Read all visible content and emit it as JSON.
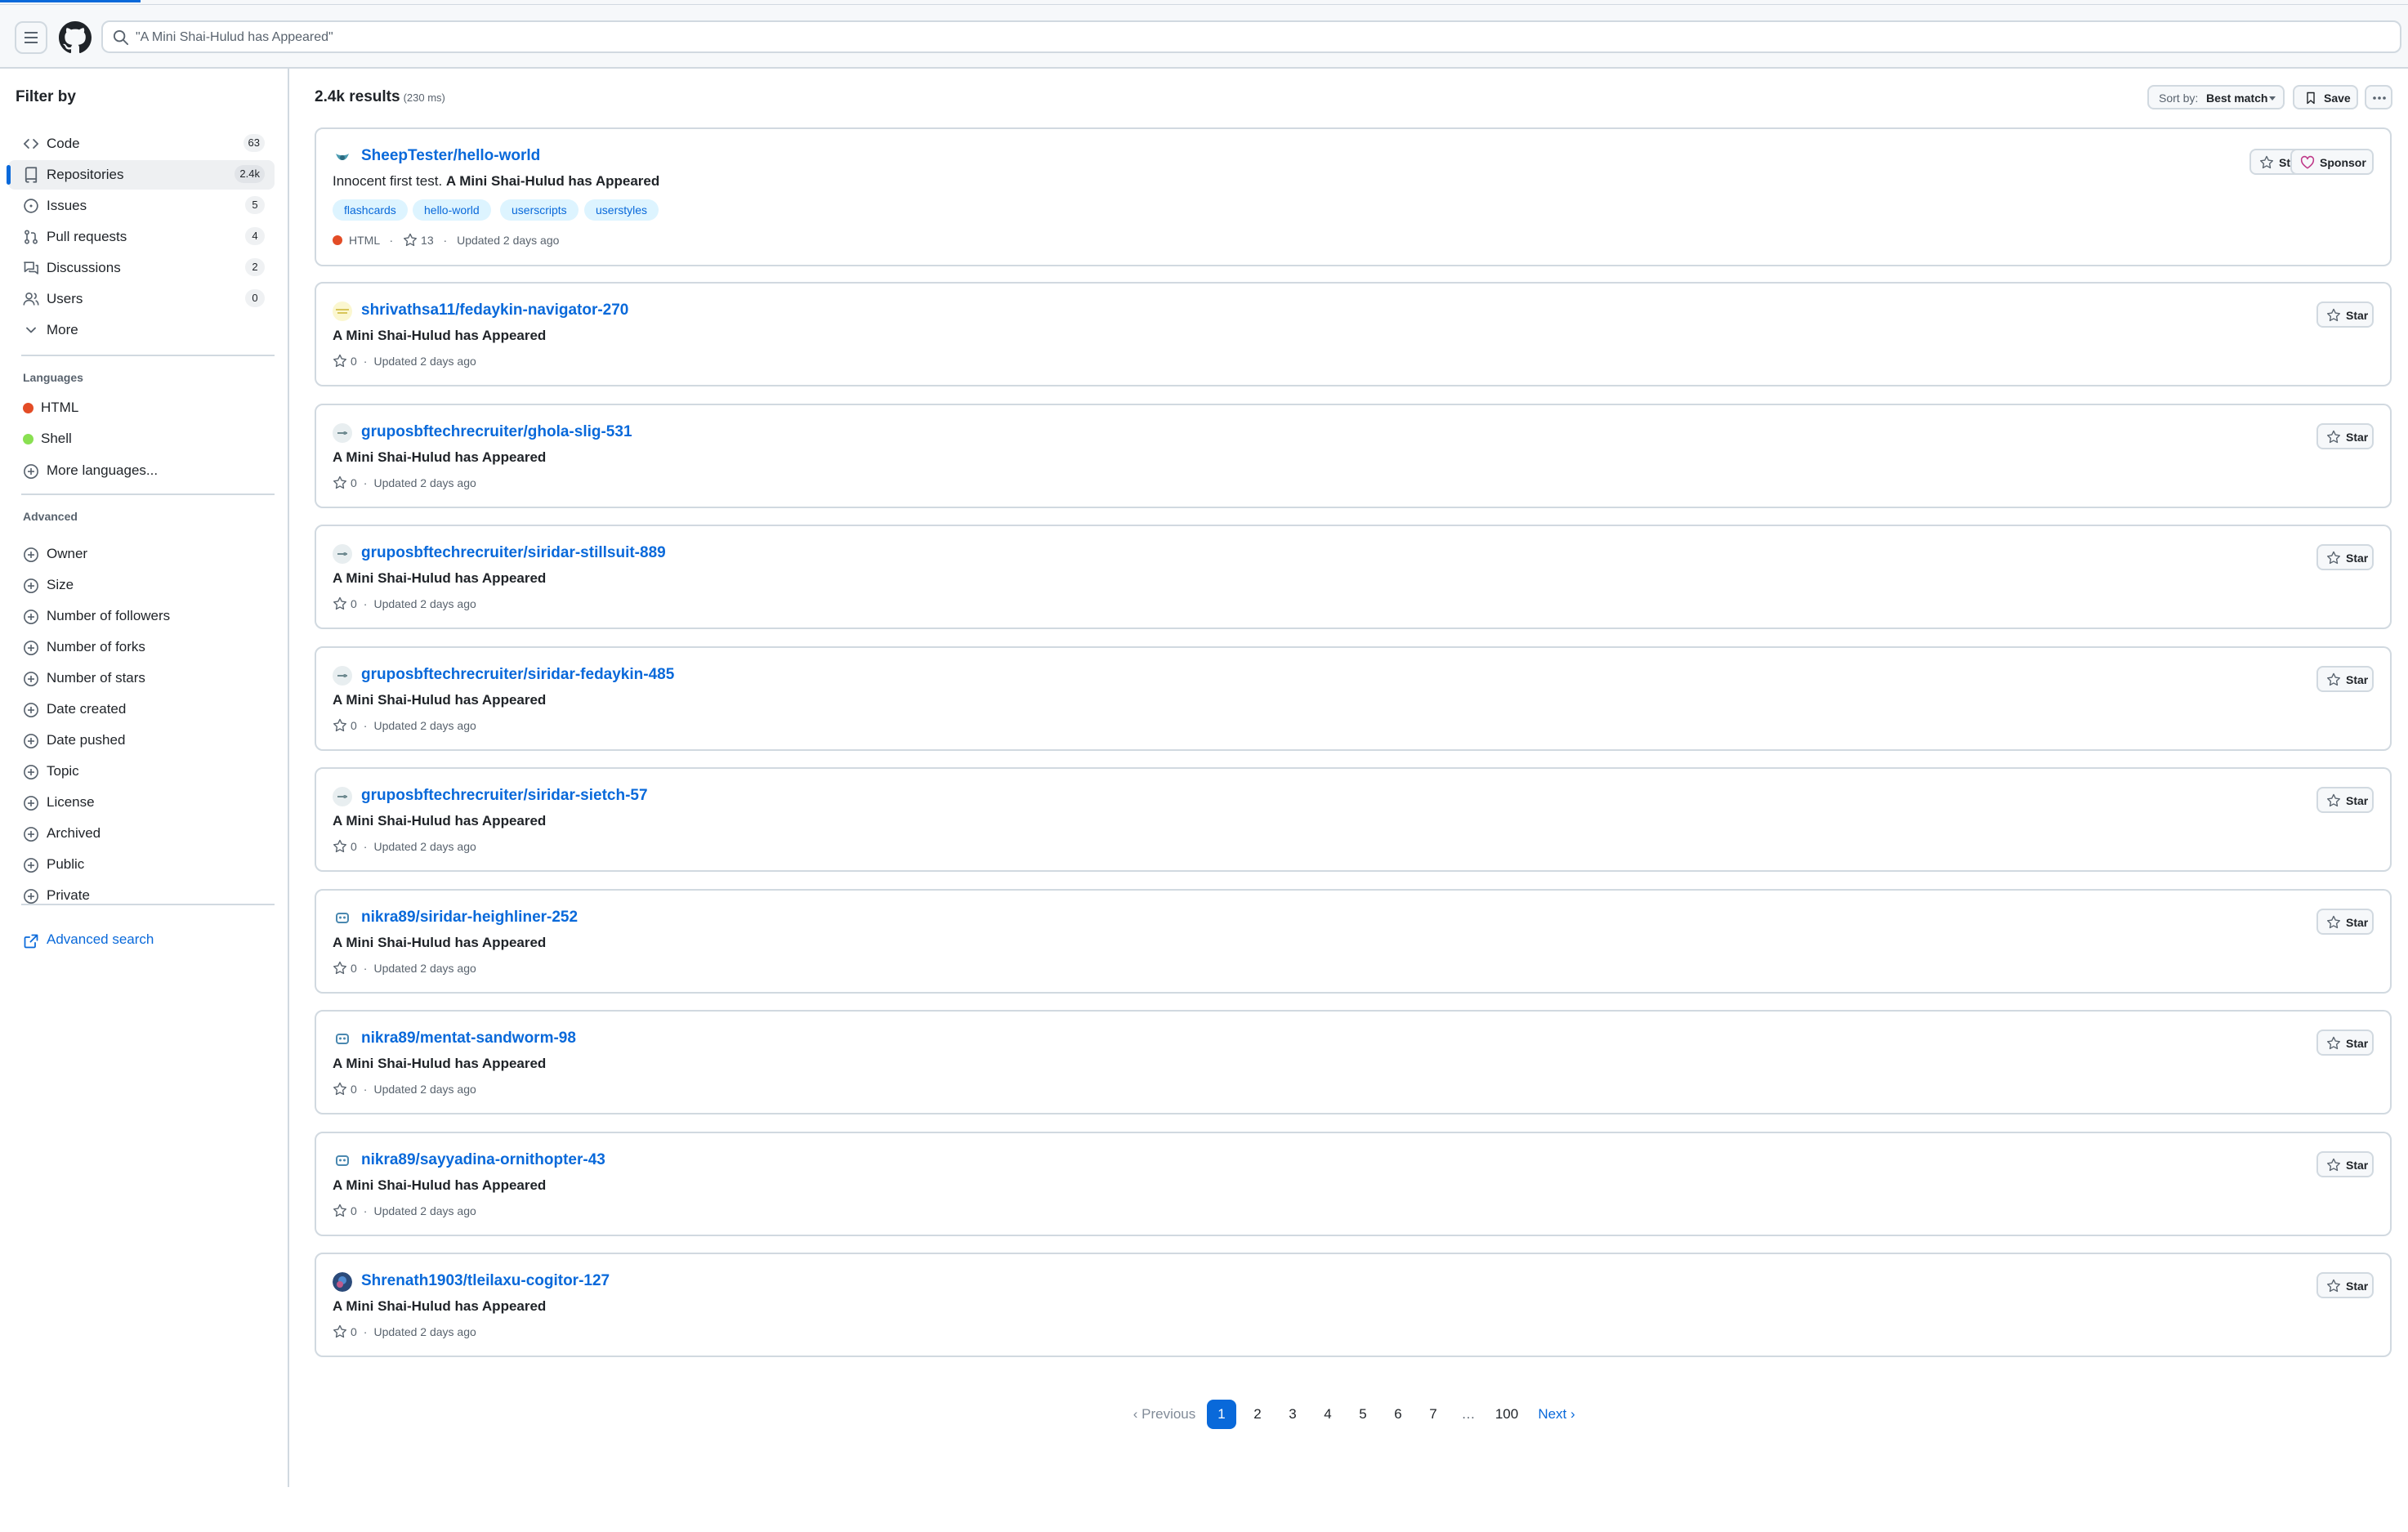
{
  "header": {
    "search_value": "\"A Mini Shai-Hulud has Appeared\""
  },
  "sidebar": {
    "title": "Filter by",
    "types": [
      {
        "label": "Code",
        "count": "63",
        "icon": "code-icon"
      },
      {
        "label": "Repositories",
        "count": "2.4k",
        "icon": "repo-icon",
        "active": true
      },
      {
        "label": "Issues",
        "count": "5",
        "icon": "issue-icon"
      },
      {
        "label": "Pull requests",
        "count": "4",
        "icon": "pull-request-icon"
      },
      {
        "label": "Discussions",
        "count": "2",
        "icon": "discussion-icon"
      },
      {
        "label": "Users",
        "count": "0",
        "icon": "people-icon"
      },
      {
        "label": "More",
        "icon": "chevron-down-icon"
      }
    ],
    "languages_heading": "Languages",
    "languages": [
      {
        "label": "HTML",
        "color": "#e34c26"
      },
      {
        "label": "Shell",
        "color": "#89e051"
      }
    ],
    "more_languages": "More languages...",
    "advanced_heading": "Advanced",
    "advanced": [
      "Owner",
      "Size",
      "Number of followers",
      "Number of forks",
      "Number of stars",
      "Date created",
      "Date pushed",
      "Topic",
      "License",
      "Archived",
      "Public",
      "Private"
    ],
    "advanced_search": "Advanced search"
  },
  "results": {
    "count": "2.4k results",
    "time": "(230 ms)",
    "sort_label": "Sort by:",
    "sort_value": "Best match",
    "save_label": "Save",
    "star_label": "Star",
    "sponsor_label": "Sponsor",
    "items": [
      {
        "repo": "SheepTester/hello-world",
        "desc_prefix": "Innocent first test. ",
        "desc": "A Mini Shai-Hulud has Appeared",
        "topics": [
          "flashcards",
          "hello-world",
          "userscripts",
          "userstyles"
        ],
        "language": "HTML",
        "stars": "13",
        "updated": "Updated 2 days ago"
      },
      {
        "repo": "shrivathsa11/fedaykin-navigator-270",
        "desc_prefix": "",
        "desc": "A Mini Shai-Hulud has Appeared",
        "stars": "0",
        "updated": "Updated 2 days ago"
      },
      {
        "repo": "gruposbftechrecruiter/ghola-slig-531",
        "desc_prefix": "",
        "desc": "A Mini Shai-Hulud has Appeared",
        "stars": "0",
        "updated": "Updated 2 days ago"
      },
      {
        "repo": "gruposbftechrecruiter/siridar-stillsuit-889",
        "desc_prefix": "",
        "desc": "A Mini Shai-Hulud has Appeared",
        "stars": "0",
        "updated": "Updated 2 days ago"
      },
      {
        "repo": "gruposbftechrecruiter/siridar-fedaykin-485",
        "desc_prefix": "",
        "desc": "A Mini Shai-Hulud has Appeared",
        "stars": "0",
        "updated": "Updated 2 days ago"
      },
      {
        "repo": "gruposbftechrecruiter/siridar-sietch-57",
        "desc_prefix": "",
        "desc": "A Mini Shai-Hulud has Appeared",
        "stars": "0",
        "updated": "Updated 2 days ago"
      },
      {
        "repo": "nikra89/siridar-heighliner-252",
        "desc_prefix": "",
        "desc": "A Mini Shai-Hulud has Appeared",
        "stars": "0",
        "updated": "Updated 2 days ago"
      },
      {
        "repo": "nikra89/mentat-sandworm-98",
        "desc_prefix": "",
        "desc": "A Mini Shai-Hulud has Appeared",
        "stars": "0",
        "updated": "Updated 2 days ago"
      },
      {
        "repo": "nikra89/sayyadina-ornithopter-43",
        "desc_prefix": "",
        "desc": "A Mini Shai-Hulud has Appeared",
        "stars": "0",
        "updated": "Updated 2 days ago"
      },
      {
        "repo": "Shrenath1903/tleilaxu-cogitor-127",
        "desc_prefix": "",
        "desc": "A Mini Shai-Hulud has Appeared",
        "stars": "0",
        "updated": "Updated 2 days ago"
      }
    ]
  },
  "pagination": {
    "previous": "Previous",
    "pages": [
      "1",
      "2",
      "3",
      "4",
      "5",
      "6",
      "7",
      "…",
      "100"
    ],
    "current": "1",
    "next": "Next"
  }
}
